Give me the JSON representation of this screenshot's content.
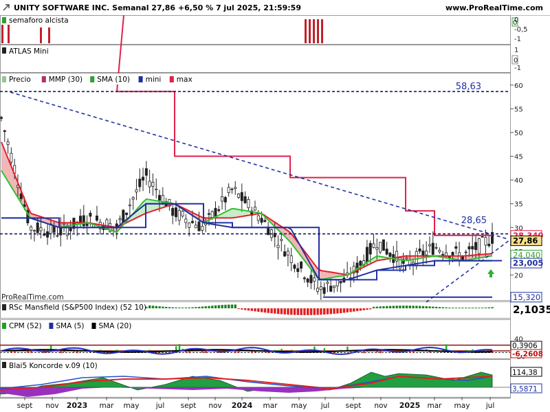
{
  "header": {
    "title": "UNITY SOFTWARE INC. Semanal 27,86 +6,50 % 7 jul 2025, 21:59:59",
    "site": "www.ProRealTime.com"
  },
  "watermark": "ProRealTime.com",
  "panels": {
    "semaforo": {
      "legend": "semaforo alcista",
      "axis": [
        "0",
        "-0,5",
        "-1"
      ]
    },
    "atlas": {
      "legend": "ATLAS Mini",
      "axis": [
        "1",
        "0",
        "-1"
      ]
    },
    "price": {
      "legends": [
        {
          "label": "Precio",
          "color": "#90c890"
        },
        {
          "label": "MMP (30)",
          "color": "#b0306a"
        },
        {
          "label": "SMA (10)",
          "color": "#30a030"
        },
        {
          "label": "mini",
          "color": "#2030a0"
        },
        {
          "label": "max",
          "color": "#e0204a"
        }
      ],
      "axis_ticks": [
        "60",
        "55",
        "50",
        "45",
        "40",
        "35",
        "30",
        "25",
        "20"
      ],
      "level_high": "58,63",
      "level_mid": "28,65",
      "badges": [
        {
          "text": "28,340",
          "color": "#e0204a",
          "bg": "#ffffff"
        },
        {
          "text": "27,86",
          "color": "#000000",
          "bg": "#f6e08a"
        },
        {
          "text": "24,040",
          "color": "#30a030",
          "bg": "#ffffff"
        },
        {
          "text": "23,005",
          "color": "#2030a0",
          "bg": "#ffffff"
        },
        {
          "text": "15,320",
          "color": "#2030a0",
          "bg": "#ffffff"
        }
      ]
    },
    "mansfield": {
      "legend": "RSc Mansfield (S&P500 Index) (52 10)",
      "value": "2,1035"
    },
    "cpm": {
      "legends": [
        {
          "label": "CPM (52)",
          "color": "#20a020"
        },
        {
          "label": "SMA (5)",
          "color": "#2030a0"
        },
        {
          "label": "SMA (20)",
          "color": "#000000"
        }
      ],
      "axis_ticks": [
        "40",
        "20",
        "0",
        "-20"
      ],
      "badges": [
        {
          "text": "0,3906",
          "color": "#000000"
        },
        {
          "text": "-6,2608",
          "color": "#c01010"
        }
      ]
    },
    "koncorde": {
      "legend": "Blai5 Koncorde v.09 (10)",
      "badges": [
        {
          "text": "114,38",
          "color": "#000000"
        },
        {
          "text": "3,5871",
          "color": "#2030a0"
        }
      ]
    }
  },
  "x_axis": {
    "labels": [
      {
        "text": "sept",
        "bold": false
      },
      {
        "text": "nov",
        "bold": false
      },
      {
        "text": "2023",
        "bold": true
      },
      {
        "text": "mar",
        "bold": false
      },
      {
        "text": "may",
        "bold": false
      },
      {
        "text": "jul",
        "bold": false
      },
      {
        "text": "sept",
        "bold": false
      },
      {
        "text": "nov",
        "bold": false
      },
      {
        "text": "2024",
        "bold": true
      },
      {
        "text": "mar",
        "bold": false
      },
      {
        "text": "may",
        "bold": false
      },
      {
        "text": "jul",
        "bold": false
      },
      {
        "text": "sept",
        "bold": false
      },
      {
        "text": "nov",
        "bold": false
      },
      {
        "text": "2025",
        "bold": true
      },
      {
        "text": "mar",
        "bold": false
      },
      {
        "text": "may",
        "bold": false
      },
      {
        "text": "jul",
        "bold": false
      }
    ]
  },
  "chart_data": {
    "type": "line",
    "title": "UNITY SOFTWARE INC. Semanal 27,86 +6,50 % 7 jul 2025, 21:59:59",
    "x": [
      "sept 2022",
      "nov 2022",
      "ene 2023",
      "mar 2023",
      "may 2023",
      "jul 2023",
      "sept 2023",
      "nov 2023",
      "ene 2024",
      "mar 2024",
      "may 2024",
      "jul 2024",
      "sept 2024",
      "nov 2024",
      "ene 2025",
      "mar 2025",
      "may 2025",
      "jul 2025"
    ],
    "series": [
      {
        "name": "Precio",
        "values": [
          53,
          30,
          29,
          32,
          30,
          41,
          33,
          30,
          38,
          32,
          24,
          17,
          19,
          27,
          22,
          26,
          24,
          27.86
        ]
      },
      {
        "name": "SMA (10)",
        "values": [
          42,
          32,
          30,
          31,
          29,
          36,
          35,
          31,
          34,
          33,
          27,
          19,
          20,
          24,
          23,
          24,
          23,
          24.04
        ]
      },
      {
        "name": "MMP (30)",
        "values": [
          48,
          33,
          31,
          31,
          30,
          33,
          35,
          32,
          32,
          33,
          29,
          21,
          20,
          23,
          24,
          24,
          24,
          24.5
        ]
      },
      {
        "name": "mini",
        "values": [
          32,
          32,
          30,
          30,
          30,
          35,
          35,
          31,
          30,
          30,
          30,
          19,
          19,
          21,
          22,
          23,
          23,
          23.005
        ]
      },
      {
        "name": "max",
        "values": [
          null,
          null,
          null,
          null,
          58.63,
          58.63,
          45,
          45,
          45,
          45,
          40.5,
          40.5,
          40.5,
          40.5,
          33.5,
          28.34,
          28.34,
          28.34
        ]
      }
    ],
    "yticks": [
      20,
      25,
      30,
      35,
      40,
      45,
      50,
      55,
      60
    ],
    "ylim": [
      15,
      62
    ],
    "levels": [
      58.63,
      28.65,
      15.32
    ],
    "last_values": {
      "max": 28.34,
      "Precio": 27.86,
      "SMA (10)": 24.04,
      "mini": 23.005,
      "support": 15.32
    },
    "indicators": {
      "RSc Mansfield (S&P500 Index) (52 10)": 2.1035,
      "CPM (52)": {
        "SMA (5)": 0.3906,
        "SMA (20)": -6.2608,
        "yticks": [
          40,
          20,
          0,
          -20
        ]
      },
      "Blai5 Koncorde v.09 (10)": [
        114.38,
        3.5871
      ]
    }
  }
}
